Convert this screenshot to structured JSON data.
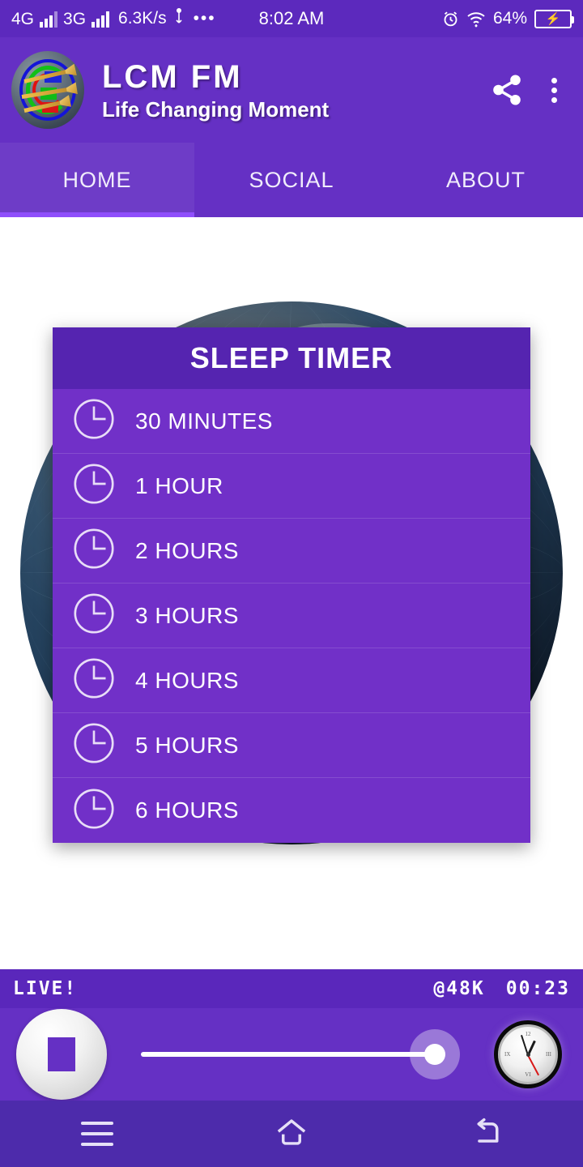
{
  "status_bar": {
    "network_4g": "4G",
    "network_3g": "3G",
    "data_speed": "6.3K/s",
    "usb_icon": "usb-icon",
    "more_dots": "•••",
    "time": "8:02 AM",
    "alarm_icon": "alarm-clock-icon",
    "wifi_icon": "wifi-icon",
    "battery_percent": "64%",
    "battery_icon": "battery-charging-icon"
  },
  "app_bar": {
    "logo_icon": "lcm-fm-logo",
    "title": "LCM  FM",
    "subtitle": "Life Changing Moment",
    "share_icon": "share-icon",
    "overflow_icon": "more-vertical-icon"
  },
  "tabs": {
    "items": [
      {
        "label": "HOME",
        "active": true
      },
      {
        "label": "SOCIAL",
        "active": false
      },
      {
        "label": "ABOUT",
        "active": false
      }
    ]
  },
  "dialog": {
    "title": "SLEEP TIMER",
    "clock_icon": "clock-icon",
    "options": [
      {
        "label": "30 MINUTES"
      },
      {
        "label": "1 HOUR"
      },
      {
        "label": "2 HOURS"
      },
      {
        "label": "3 HOURS"
      },
      {
        "label": "4 HOURS"
      },
      {
        "label": "5 HOURS"
      },
      {
        "label": "6 HOURS"
      }
    ]
  },
  "player": {
    "live_label": "LIVE!",
    "bitrate": "@48K",
    "elapsed": "00:23",
    "stop_icon": "stop-icon",
    "volume_slider": "volume-slider",
    "sleep_timer_icon": "analog-clock-icon"
  },
  "nav_bar": {
    "menu_icon": "menu-icon",
    "home_icon": "home-icon",
    "back_icon": "back-icon"
  },
  "colors": {
    "status_bar": "#5c29bd",
    "app_bar": "#6530c4",
    "tab_indicator": "#8f4ffb",
    "dialog_header": "#5524b0",
    "dialog_row": "#7130c8",
    "player_strip": "#5a27bb",
    "nav_bar": "#4d2bab"
  }
}
